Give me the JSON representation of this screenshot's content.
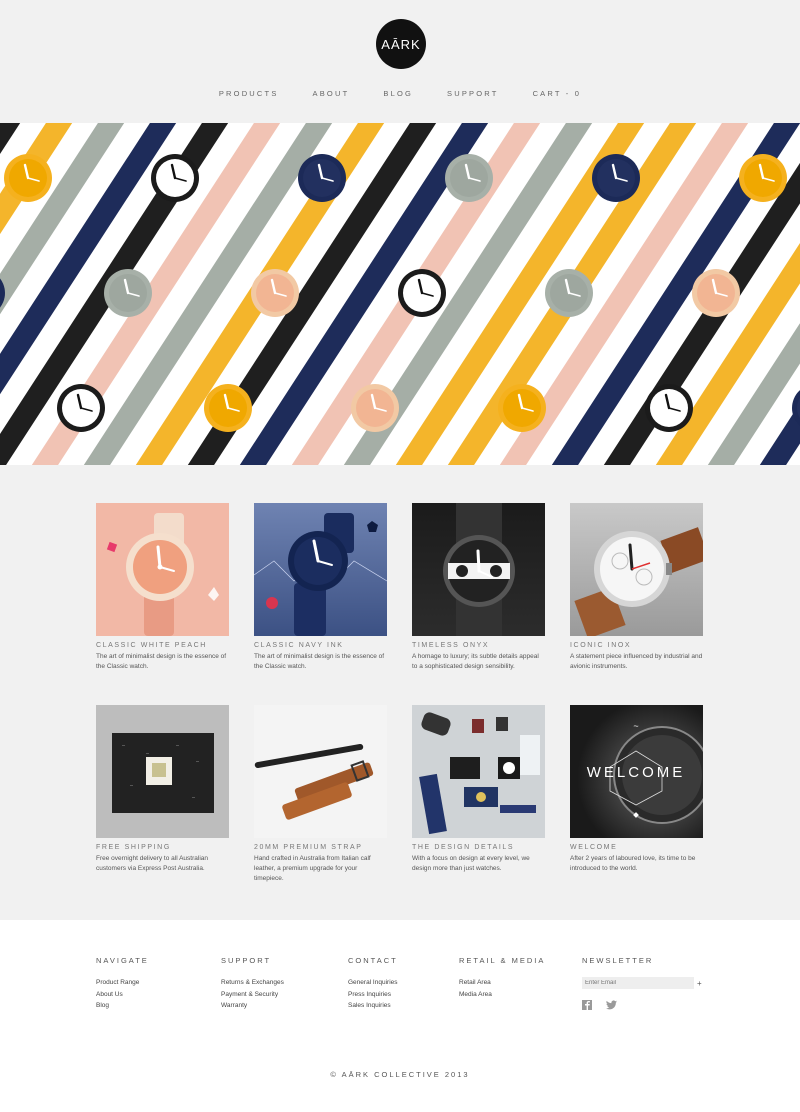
{
  "brand": {
    "logo_text": "AĀRK"
  },
  "nav": {
    "items": [
      {
        "label": "PRODUCTS"
      },
      {
        "label": "ABOUT"
      },
      {
        "label": "BLOG"
      },
      {
        "label": "SUPPORT"
      },
      {
        "label": "CART - 0"
      }
    ]
  },
  "products_row1": [
    {
      "title": "CLASSIC WHITE PEACH",
      "desc": "The art of minimalist design is the essence of the Classic watch."
    },
    {
      "title": "CLASSIC NAVY INK",
      "desc": "The art of minimalist design is the essence of the Classic watch."
    },
    {
      "title": "TIMELESS ONYX",
      "desc": "A homage to luxury; its subtle details appeal to a sophisticated design sensibility."
    },
    {
      "title": "ICONIC INOX",
      "desc": "A statement piece influenced by industrial and avionic instruments."
    }
  ],
  "products_row2": [
    {
      "title": "FREE SHIPPING",
      "desc": "Free overnight delivery to all Australian customers via Express Post Australia."
    },
    {
      "title": "20MM PREMIUM STRAP",
      "desc": "Hand crafted in Australia from Italian calf leather, a premium upgrade for your timepiece."
    },
    {
      "title": "THE DESIGN DETAILS",
      "desc": "With a focus on design at every level, we design more than just watches."
    },
    {
      "title": "WELCOME",
      "desc": "After 2 years of laboured love, its time to be introduced to the world.",
      "overlay_text": "WELCOME"
    }
  ],
  "footer": {
    "navigate": {
      "heading": "NAVIGATE",
      "links": [
        "Product Range",
        "About Us",
        "Blog"
      ]
    },
    "support": {
      "heading": "SUPPORT",
      "links": [
        "Returns & Exchanges",
        "Payment & Security",
        "Warranty"
      ]
    },
    "contact": {
      "heading": "CONTACT",
      "links": [
        "General Inquiries",
        "Press Inquiries",
        "Sales Inquiries"
      ]
    },
    "retail": {
      "heading": "RETAIL & MEDIA",
      "links": [
        "Retail Area",
        "Media Area"
      ]
    },
    "newsletter": {
      "heading": "NEWSLETTER",
      "placeholder": "Enter Email",
      "submit": "+"
    },
    "social_icons": [
      "facebook-icon",
      "twitter-icon"
    ],
    "copyright": "© AĀRK COLLECTIVE 2013"
  },
  "colors": {
    "page_bg": "#f1f1f1",
    "yellow": "#f4b52b",
    "peach": "#f1c3b4",
    "navy": "#1e2c5a",
    "sage": "#a5aea6",
    "black": "#1f1f1f"
  }
}
